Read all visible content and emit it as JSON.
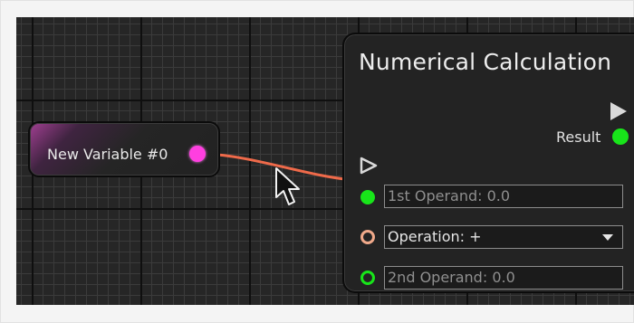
{
  "variable_node": {
    "label": "New Variable #0",
    "output_port_color": "#ff3fe0"
  },
  "calc_node": {
    "title": "Numerical Calculation",
    "result_label": "Result",
    "inputs": {
      "first_operand": "1st Operand: 0.0",
      "operation": "Operation: +",
      "second_operand": "2nd Operand: 0.0"
    }
  },
  "colors": {
    "canvas_background": "#262626",
    "wire": "#ef6a4a",
    "green_port": "#18e51a",
    "orange_port": "#f0a98a"
  },
  "icons": {
    "exec_output": "play-triangle-icon",
    "exec_input": "play-outline-icon",
    "cursor": "mouse-pointer-icon",
    "dropdown": "chevron-down-icon"
  }
}
